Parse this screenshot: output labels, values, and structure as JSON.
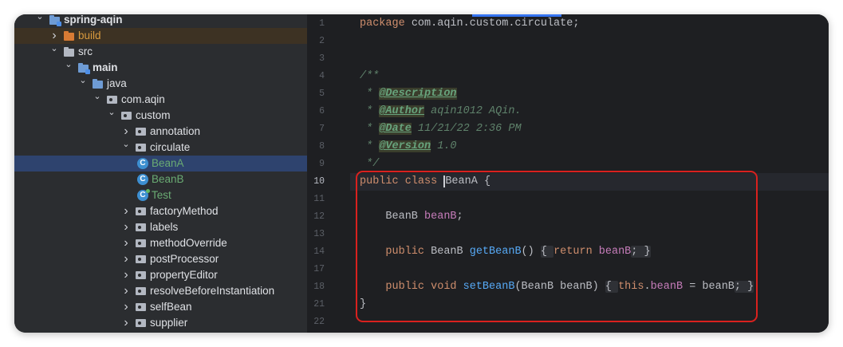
{
  "project_tree": [
    {
      "label": "spring-aqin",
      "depth": 0,
      "arrow": "down",
      "icon": "module-folder-icon",
      "bold": true
    },
    {
      "label": "build",
      "depth": 1,
      "arrow": "right",
      "icon": "excluded-folder-icon",
      "style": "orange"
    },
    {
      "label": "src",
      "depth": 1,
      "arrow": "down",
      "icon": "folder-icon"
    },
    {
      "label": "main",
      "depth": 2,
      "arrow": "down",
      "icon": "module-folder-icon",
      "bold": true
    },
    {
      "label": "java",
      "depth": 3,
      "arrow": "down",
      "icon": "source-folder-icon"
    },
    {
      "label": "com.aqin",
      "depth": 4,
      "arrow": "down",
      "icon": "package-icon"
    },
    {
      "label": "custom",
      "depth": 5,
      "arrow": "down",
      "icon": "package-icon"
    },
    {
      "label": "annotation",
      "depth": 6,
      "arrow": "right",
      "icon": "package-icon"
    },
    {
      "label": "circulate",
      "depth": 6,
      "arrow": "down",
      "icon": "package-icon"
    },
    {
      "label": "BeanA",
      "depth": 7,
      "arrow": "",
      "icon": "class-icon",
      "style": "green",
      "selected": true
    },
    {
      "label": "BeanB",
      "depth": 7,
      "arrow": "",
      "icon": "class-icon",
      "style": "green"
    },
    {
      "label": "Test",
      "depth": 7,
      "arrow": "",
      "icon": "runnable-class-icon",
      "style": "green"
    },
    {
      "label": "factoryMethod",
      "depth": 6,
      "arrow": "right",
      "icon": "package-icon"
    },
    {
      "label": "labels",
      "depth": 6,
      "arrow": "right",
      "icon": "package-icon"
    },
    {
      "label": "methodOverride",
      "depth": 6,
      "arrow": "right",
      "icon": "package-icon"
    },
    {
      "label": "postProcessor",
      "depth": 6,
      "arrow": "right",
      "icon": "package-icon"
    },
    {
      "label": "propertyEditor",
      "depth": 6,
      "arrow": "right",
      "icon": "package-icon"
    },
    {
      "label": "resolveBeforeInstantiation",
      "depth": 6,
      "arrow": "right",
      "icon": "package-icon"
    },
    {
      "label": "selfBean",
      "depth": 6,
      "arrow": "right",
      "icon": "package-icon"
    },
    {
      "label": "supplier",
      "depth": 6,
      "arrow": "right",
      "icon": "package-icon"
    }
  ],
  "class_icon_letter": "C",
  "editor": {
    "current_line": "10",
    "lines": [
      {
        "n": "1",
        "tokens": [
          [
            "kw",
            "package "
          ],
          [
            "",
            "com.aqin.custom.circulate;"
          ]
        ]
      },
      {
        "n": "2",
        "tokens": []
      },
      {
        "n": "3",
        "tokens": []
      },
      {
        "n": "4",
        "tokens": [
          [
            "doc",
            "/**"
          ]
        ],
        "fold": true
      },
      {
        "n": "5",
        "tokens": [
          [
            "doc",
            " * "
          ],
          [
            "tag",
            "@Description"
          ]
        ]
      },
      {
        "n": "6",
        "tokens": [
          [
            "doc",
            " * "
          ],
          [
            "tag",
            "@Author"
          ],
          [
            "doc",
            " aqin1012 AQin."
          ]
        ]
      },
      {
        "n": "7",
        "tokens": [
          [
            "doc",
            " * "
          ],
          [
            "tag",
            "@Date"
          ],
          [
            "doc",
            " 11/21/22 2:36 PM"
          ]
        ]
      },
      {
        "n": "8",
        "tokens": [
          [
            "doc",
            " * "
          ],
          [
            "tag",
            "@Version"
          ],
          [
            "doc",
            " 1.0"
          ]
        ]
      },
      {
        "n": "9",
        "tokens": [
          [
            "doc",
            " */"
          ]
        ],
        "fold": true
      },
      {
        "n": "10",
        "tokens": [
          [
            "kw",
            "public class "
          ],
          [
            "caret",
            "BeanA"
          ],
          [
            "",
            " {"
          ]
        ]
      },
      {
        "n": "11",
        "tokens": []
      },
      {
        "n": "12",
        "tokens": [
          [
            "",
            "    BeanB "
          ],
          [
            "fld",
            "beanB"
          ],
          [
            "",
            ";"
          ]
        ]
      },
      {
        "n": "13",
        "tokens": []
      },
      {
        "n": "14",
        "tokens": [
          [
            "kw",
            "    public "
          ],
          [
            "",
            "BeanB "
          ],
          [
            "fn",
            "getBeanB"
          ],
          [
            "",
            "() "
          ],
          [
            "fb",
            "{ "
          ],
          [
            "kw",
            "return "
          ],
          [
            "fld",
            "beanB"
          ],
          [
            "fb",
            "; }"
          ]
        ],
        "fold": true
      },
      {
        "n": "17",
        "tokens": []
      },
      {
        "n": "18",
        "tokens": [
          [
            "kw",
            "    public void "
          ],
          [
            "fn",
            "setBeanB"
          ],
          [
            "",
            "(BeanB beanB) "
          ],
          [
            "fb",
            "{ "
          ],
          [
            "kw",
            "this"
          ],
          [
            "",
            "."
          ],
          [
            "fld",
            "beanB"
          ],
          [
            "",
            " = beanB"
          ],
          [
            "fb",
            "; }"
          ]
        ],
        "fold": true
      },
      {
        "n": "21",
        "tokens": [
          [
            "",
            "}"
          ]
        ]
      },
      {
        "n": "22",
        "tokens": []
      }
    ]
  }
}
